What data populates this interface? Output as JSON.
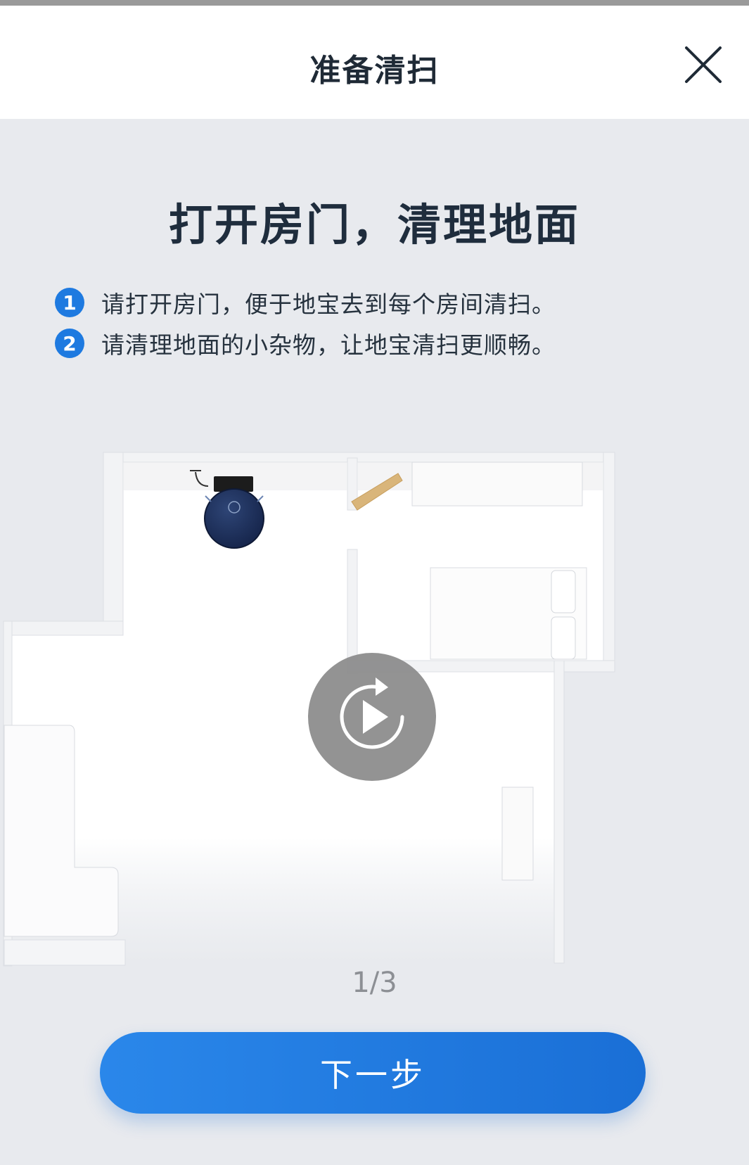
{
  "header": {
    "title": "准备清扫",
    "close_icon": "close-icon"
  },
  "main": {
    "title": "打开房门，清理地面",
    "tips": [
      {
        "number": "1",
        "text": "请打开房门，便于地宝去到每个房间清扫。"
      },
      {
        "number": "2",
        "text": "请清理地面的小杂物，让地宝清扫更顺畅。"
      }
    ],
    "illustration": {
      "play_icon": "replay-play-icon"
    },
    "page_indicator": "1/3"
  },
  "footer": {
    "next_label": "下一步"
  },
  "colors": {
    "accent": "#1e7ae0",
    "background": "#e8eaee",
    "robot": "#1b2c54"
  }
}
